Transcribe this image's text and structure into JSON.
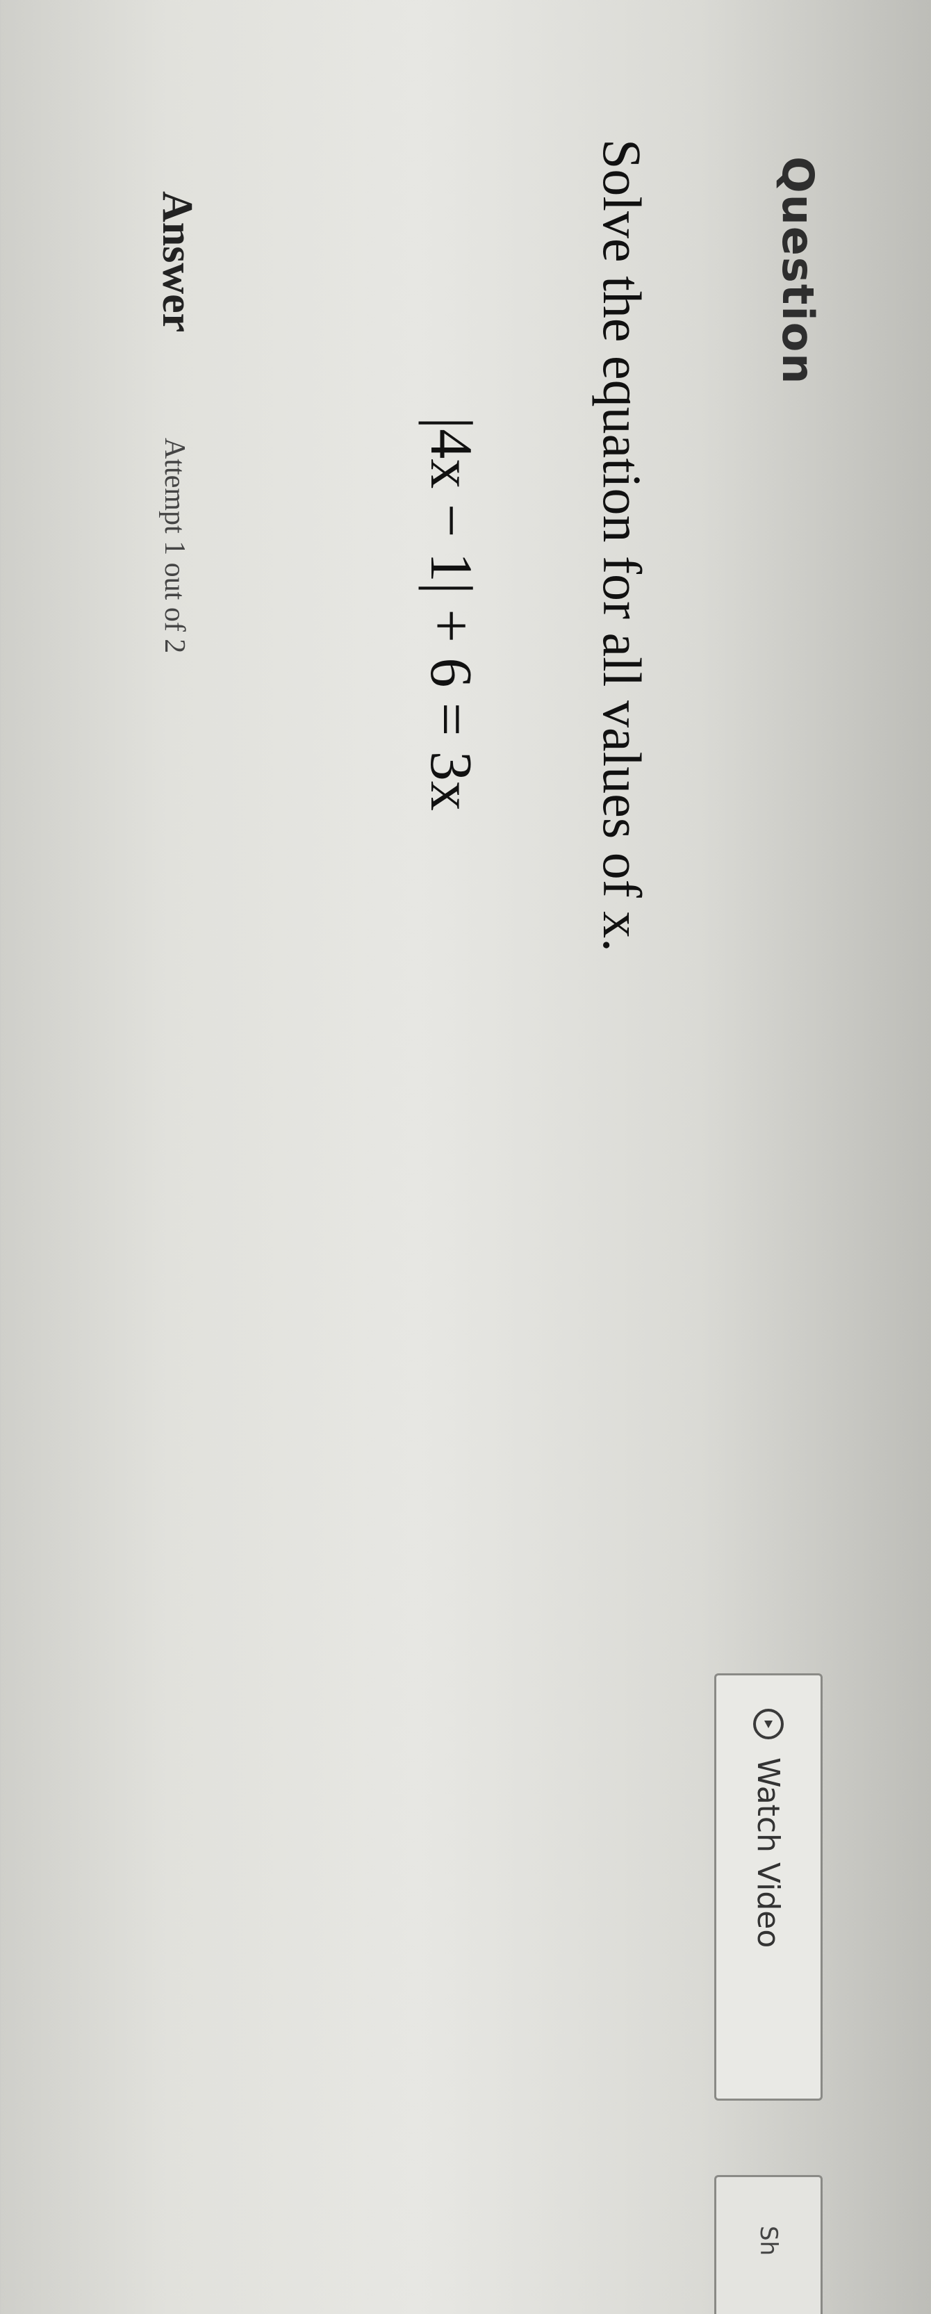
{
  "question": {
    "heading": "Question",
    "prompt": "Solve the equation for all values of x.",
    "equation": "|4x − 1| + 6 = 3x"
  },
  "toolbar": {
    "watch_video_label": "Watch Video",
    "watch_video_icon": "play-circle-icon",
    "next_button_label": "Sh"
  },
  "answer": {
    "label": "Answer",
    "attempt_text": "Attempt 1 out of 2"
  }
}
